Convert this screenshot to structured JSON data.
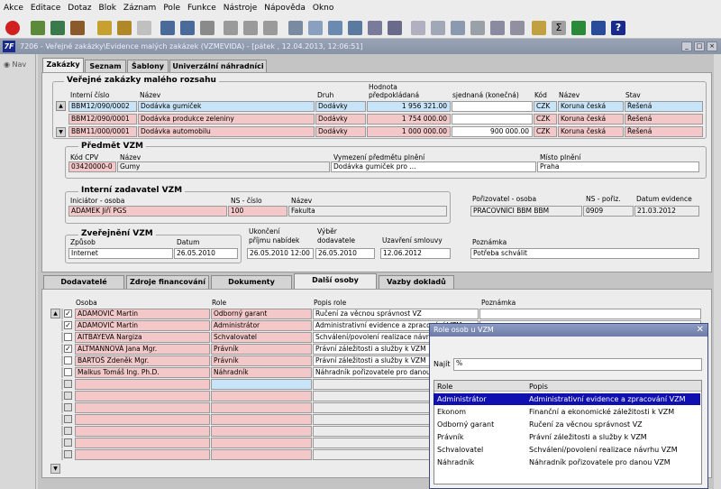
{
  "menu": [
    "Akce",
    "Editace",
    "Dotaz",
    "Blok",
    "Záznam",
    "Pole",
    "Funkce",
    "Nástroje",
    "Nápověda",
    "Okno"
  ],
  "app_icon_label": "7F",
  "window_title": "7206 - Veřejné zakázky\\Evidence malých zakázek (VZMEVIDA) - [pátek , 12.04.2013, 12:06:51]",
  "nav_label": "Nav",
  "top_tabs": [
    "Zakázky",
    "Seznam",
    "Šablony",
    "Univerzální náhradníci"
  ],
  "main_title": "Veřejné zakázky malého rozsahu",
  "contracts": {
    "headers": {
      "internal_no": "Interní číslo",
      "name": "Název",
      "kind": "Druh",
      "value_group": "Hodnota",
      "value_estimated": "předpokládaná",
      "value_agreed": "sjednaná (konečná)",
      "code": "Kód",
      "currency_name": "Název",
      "state": "Stav"
    },
    "rows": [
      {
        "internal_no": "BBM12/090/0002",
        "name": "Dodávka gumiček",
        "kind": "Dodávky",
        "estimated": "1 956 321.00",
        "agreed": "",
        "code": "CZK",
        "currency": "Koruna česká",
        "state": "Řešená"
      },
      {
        "internal_no": "BBM12/090/0001",
        "name": "Dodávka produkce zeleniny",
        "kind": "Dodávky",
        "estimated": "1 754 000.00",
        "agreed": "",
        "code": "CZK",
        "currency": "Koruna česká",
        "state": "Řešená"
      },
      {
        "internal_no": "BBM11/000/0001",
        "name": "Dodávka automobilu",
        "kind": "Dodávky",
        "estimated": "1 000 000.00",
        "agreed": "900 000.00",
        "code": "CZK",
        "currency": "Koruna česká",
        "state": "Řešená"
      }
    ]
  },
  "subject": {
    "title": "Předmět VZM",
    "cpv_label": "Kód CPV",
    "cpv": "03420000-0",
    "name_label": "Název",
    "name": "Gumy",
    "definition_label": "Vymezení předmětu plnění",
    "definition": "Dodávka gumiček pro ...",
    "place_label": "Místo plnění",
    "place": "Praha"
  },
  "internal": {
    "title": "Interní zadavatel VZM",
    "initiator_label": "Iniciátor - osoba",
    "initiator": "ADÁMEK Jiří PGS",
    "ns_label": "NS - číslo",
    "ns": "100",
    "name_label": "Název",
    "name": "Fakulta",
    "creator_label": "Pořizovatel - osoba",
    "creator": "PRACOVNÍCI BBM BBM",
    "ns_creator_label": "NS - pořiz.",
    "ns_creator": "0909",
    "date_label": "Datum evidence",
    "date": "21.03.2012"
  },
  "publication": {
    "title": "Zveřejnění VZM",
    "method_label": "Způsob",
    "method": "Internet",
    "date_label": "Datum",
    "date": "26.05.2010",
    "end_label_1": "Ukončení",
    "end_label_2": "příjmu nabídek",
    "end": "26.05.2010 12:00",
    "select_label_1": "Výběr",
    "select_label_2": "dodavatele",
    "select": "26.05.2010",
    "contract_label": "Uzavření smlouvy",
    "contract": "12.06.2012",
    "note_label": "Poznámka",
    "note": "Potřeba schválit"
  },
  "bottom_tabs": [
    "Dodavatelé",
    "Zdroje financování",
    "Dokumenty",
    "Další osoby",
    "Vazby dokladů"
  ],
  "persons": {
    "headers": {
      "person": "Osoba",
      "role": "Role",
      "desc": "Popis role",
      "note": "Poznámka"
    },
    "rows": [
      {
        "checked": true,
        "person": "ADAMOVIČ Martin",
        "role": "Odborný garant",
        "desc": "Ručení za věcnou správnost VZ"
      },
      {
        "checked": true,
        "person": "ADAMOVIČ Martin",
        "role": "Administrátor",
        "desc": "Administrativní evidence a zpracování VZM"
      },
      {
        "checked": false,
        "person": "AITBAYEVA Nargiza",
        "role": "Schvalovatel",
        "desc": "Schválení/povolení realizace návrhu VZM"
      },
      {
        "checked": true,
        "person": "ALTMANNOVÁ Jana Mgr.",
        "role": "Právník",
        "desc": "Právní záležitosti a služby k VZM"
      },
      {
        "checked": false,
        "person": "BARTOŠ Zdeněk Mgr.",
        "role": "Právník",
        "desc": "Právní záležitosti a služby k VZM"
      },
      {
        "checked": false,
        "person": "Malkus Tomáš Ing. Ph.D.",
        "role": "Náhradník",
        "desc": "Náhradník pořizovatele pro danou VZM"
      }
    ]
  },
  "popup": {
    "title": "Role osob u VZM",
    "find_label": "Najít",
    "find_value": "%",
    "col_role": "Role",
    "col_desc": "Popis",
    "rows": [
      {
        "role": "Administrátor",
        "desc": "Administrativní evidence a zpracování VZM"
      },
      {
        "role": "Ekonom",
        "desc": "Finanční a ekonomické záležitosti k VZM"
      },
      {
        "role": "Odborný garant",
        "desc": "Ručení za věcnou správnost VZ"
      },
      {
        "role": "Právník",
        "desc": "Právní záležitosti a služby k VZM"
      },
      {
        "role": "Schvalovatel",
        "desc": "Schválení/povolení realizace návrhu VZM"
      },
      {
        "role": "Náhradník",
        "desc": "Náhradník pořizovatele pro danou VZM"
      }
    ]
  },
  "colors": {
    "selection": "#1010b0",
    "required": "#f4c8c8",
    "current_row": "#c8e4f8",
    "title_bar": "#8894a6"
  }
}
